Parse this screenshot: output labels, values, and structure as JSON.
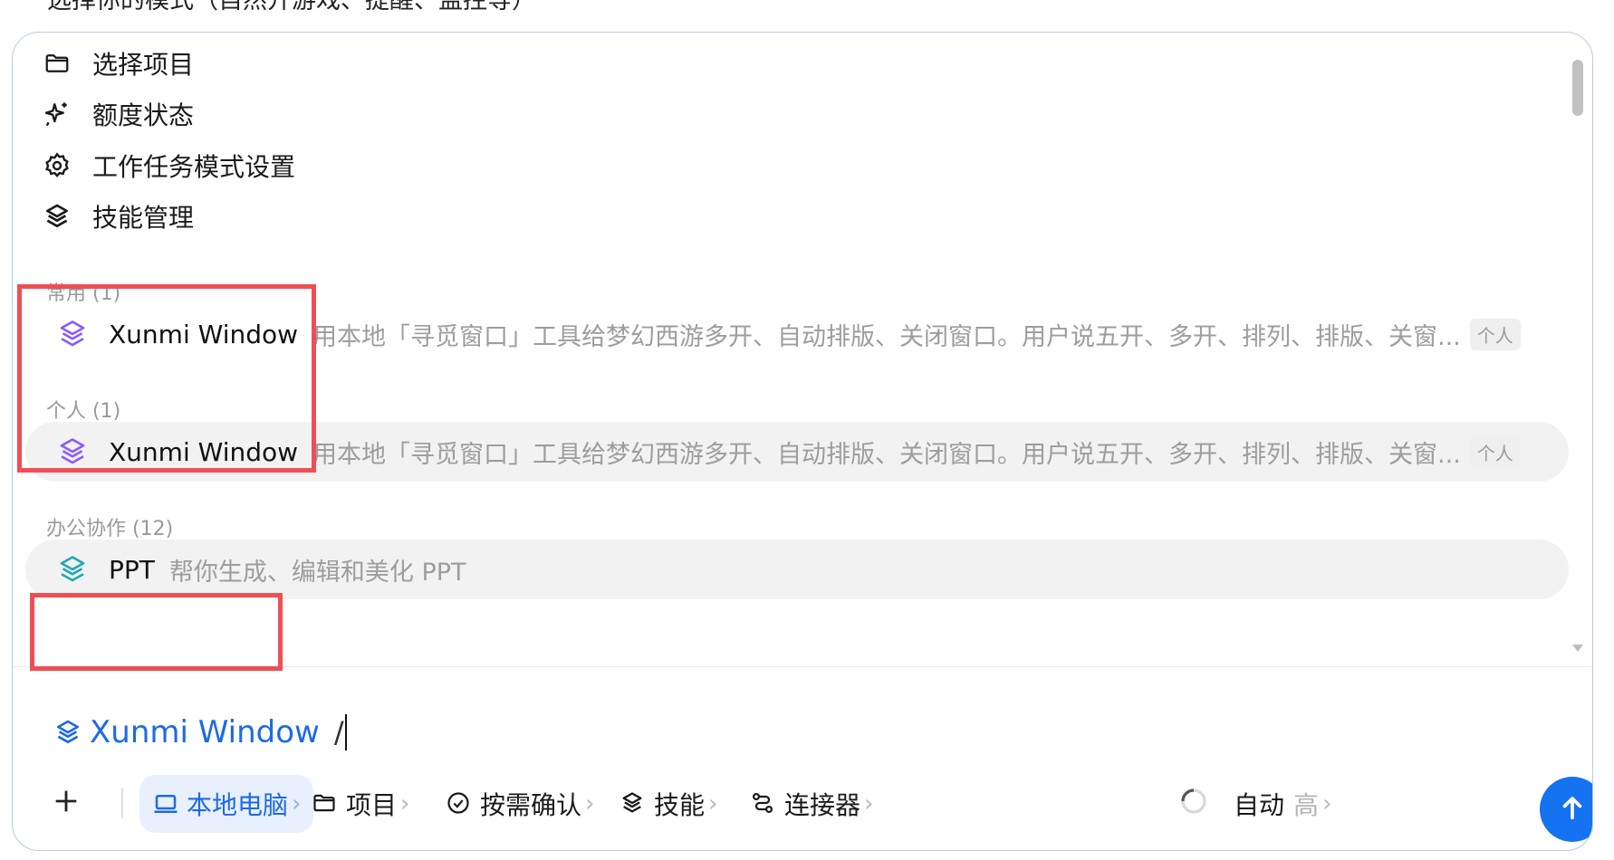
{
  "top_text": "选择你的模式（自然开游戏、提醒、监控等）",
  "menu": [
    {
      "icon": "folder-icon",
      "label": "选择项目"
    },
    {
      "icon": "sparkle-icon",
      "label": "额度状态"
    },
    {
      "icon": "gear-icon",
      "label": "工作任务模式设置"
    },
    {
      "icon": "layers-icon",
      "label": "技能管理"
    }
  ],
  "sections": {
    "common": "常用 (1)",
    "personal": "个人 (1)",
    "office": "办公协作 (12)"
  },
  "skills": {
    "common_item": {
      "name": "Xunmi Window",
      "desc": "用本地「寻觅窗口」工具给梦幻西游多开、自动排版、关闭窗口。用户说五开、多开、排列、排版、关窗...",
      "tag": "个人"
    },
    "personal_item": {
      "name": "Xunmi Window",
      "desc": "用本地「寻觅窗口」工具给梦幻西游多开、自动排版、关闭窗口。用户说五开、多开、排列、排版、关窗...",
      "tag": "个人"
    },
    "office_item": {
      "name": "PPT",
      "desc": "帮你生成、编辑和美化 PPT"
    }
  },
  "input": {
    "chip_label": "Xunmi Window",
    "typed": "/"
  },
  "toolbar": {
    "add": "+",
    "local": "本地电脑",
    "project": "项目",
    "confirm": "按需确认",
    "skills": "技能",
    "connector": "连接器",
    "auto": "自动",
    "level": "高",
    "chevron": "›"
  },
  "colors": {
    "accent": "#1572f0",
    "highlight_box": "#ee4f55",
    "skill_purple": "#8b5cf6",
    "skill_teal": "#22a7b5"
  }
}
